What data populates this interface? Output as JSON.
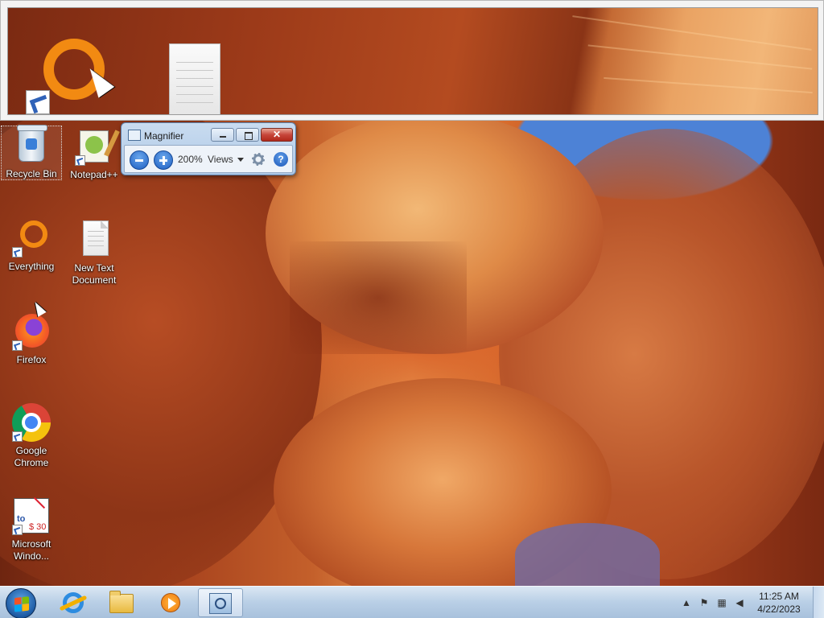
{
  "desktop": {
    "icons": [
      {
        "label": "Recycle Bin",
        "icon": "recycle-bin-icon"
      },
      {
        "label": "Notepad++",
        "icon": "notepad-plus-plus-icon"
      },
      {
        "label": "Everything",
        "icon": "everything-icon"
      },
      {
        "label": "New Text Document",
        "icon": "text-document-icon"
      },
      {
        "label": "Firefox",
        "icon": "firefox-icon"
      },
      {
        "label": "Google Chrome",
        "icon": "chrome-icon"
      },
      {
        "label": "Microsoft Windo...",
        "icon": "microsoft-translator-icon"
      }
    ]
  },
  "magnifier": {
    "title": "Magnifier",
    "zoom_level": "200%",
    "views_label": "Views",
    "help_label": "?"
  },
  "taskbar": {
    "pinned": [
      {
        "icon": "internet-explorer-icon"
      },
      {
        "icon": "windows-explorer-icon"
      },
      {
        "icon": "windows-media-player-icon"
      },
      {
        "icon": "magnifier-icon",
        "active": true
      }
    ],
    "tray": {
      "time": "11:25 AM",
      "date": "4/22/2023"
    }
  },
  "colors": {
    "taskbar": "#b9cfe6",
    "accent": "#1e5fc2",
    "close": "#c7463a"
  }
}
